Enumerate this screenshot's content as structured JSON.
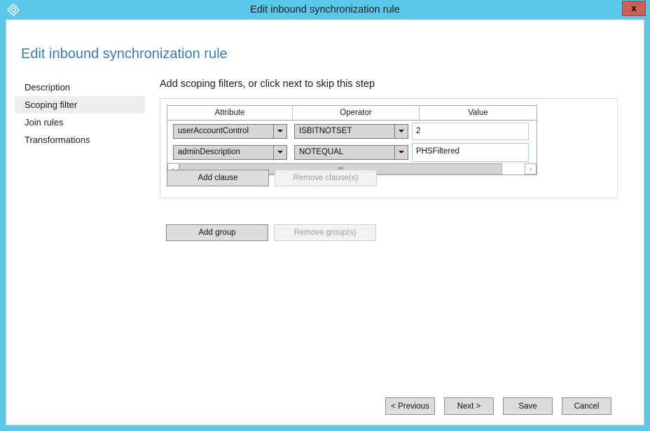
{
  "window": {
    "title": "Edit inbound synchronization rule",
    "app_icon": "azure-ad-connect-diamond-icon",
    "close_label": "x",
    "titlebar_color": "#5bc8ea",
    "close_button_color": "#c9605c"
  },
  "page": {
    "title": "Edit inbound synchronization rule",
    "title_color": "#3c7bb1"
  },
  "sidebar": {
    "items": [
      {
        "label": "Description",
        "selected": false
      },
      {
        "label": "Scoping filter",
        "selected": true
      },
      {
        "label": "Join rules",
        "selected": false
      },
      {
        "label": "Transformations",
        "selected": false
      }
    ]
  },
  "main": {
    "heading": "Add scoping filters, or click next to skip this step",
    "grid": {
      "columns": [
        "Attribute",
        "Operator",
        "Value"
      ],
      "rows": [
        {
          "attribute": "userAccountControl",
          "operator": "ISBITNOTSET",
          "value": "2",
          "value_focused": false
        },
        {
          "attribute": "adminDescription",
          "operator": "NOTEQUAL",
          "value": "PHSFiltered",
          "value_focused": true
        }
      ],
      "scrollbar": {
        "left_arrow": "‹",
        "right_arrow": "›",
        "grip": "grip-marks"
      }
    },
    "clause_buttons": {
      "add": {
        "label": "Add clause",
        "enabled": true
      },
      "remove": {
        "label": "Remove clause(s)",
        "enabled": false
      }
    },
    "group_buttons": {
      "add": {
        "label": "Add group",
        "enabled": true
      },
      "remove": {
        "label": "Remove group(s)",
        "enabled": false
      }
    }
  },
  "footer": {
    "buttons": [
      {
        "label": "< Previous",
        "enabled": true
      },
      {
        "label": "Next >",
        "enabled": true
      },
      {
        "label": "Save",
        "enabled": true
      },
      {
        "label": "Cancel",
        "enabled": true
      }
    ]
  }
}
